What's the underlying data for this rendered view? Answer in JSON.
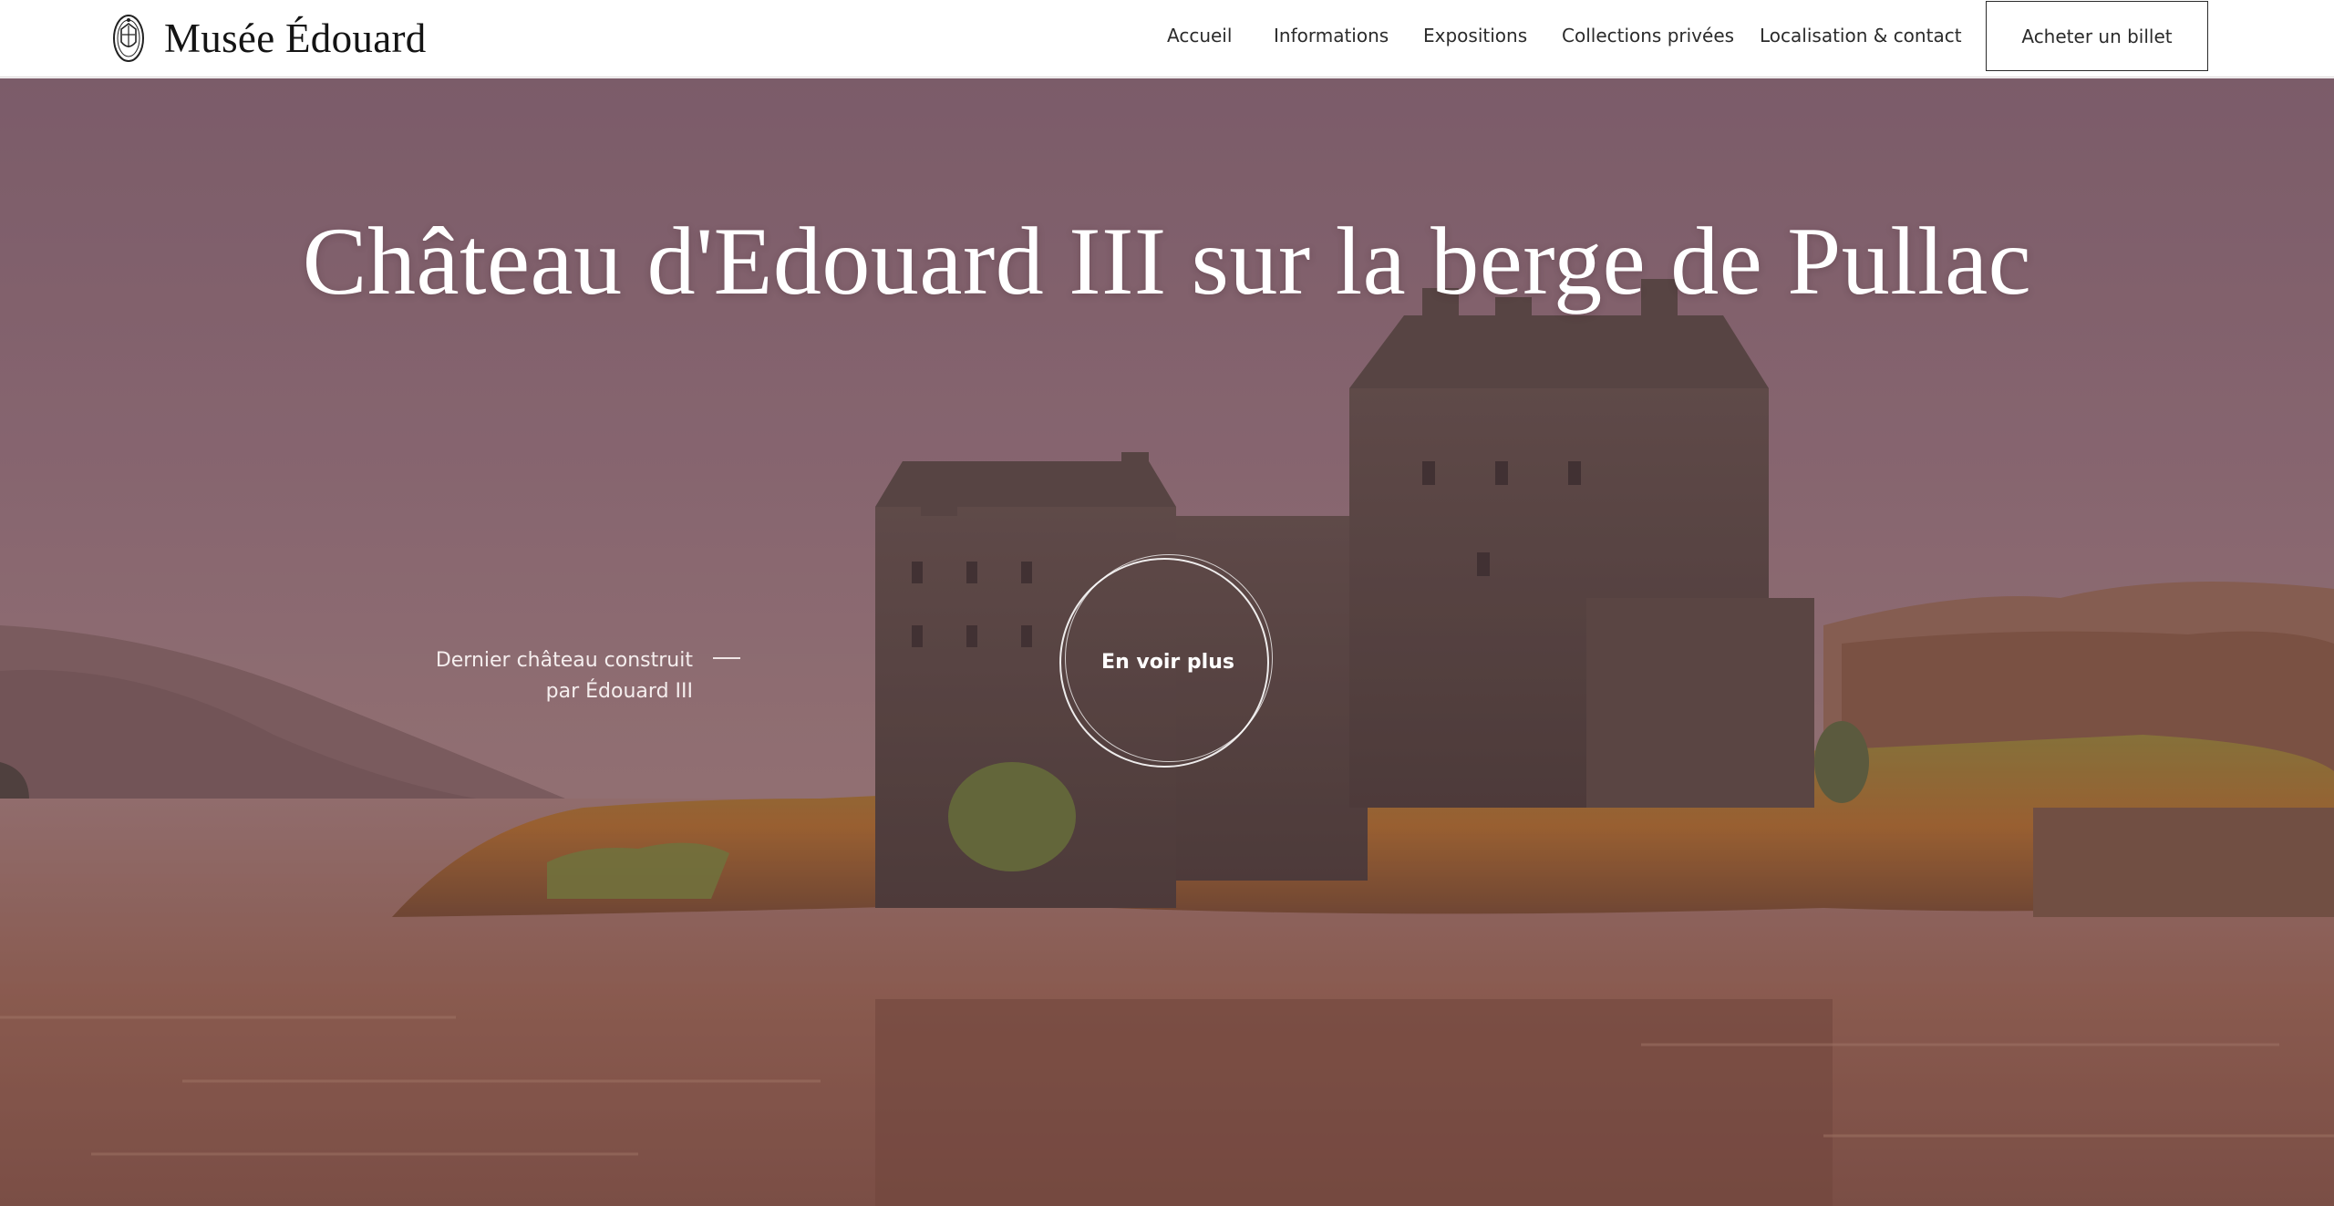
{
  "header": {
    "brand": "Musée Édouard",
    "logo_icon": "crest-icon",
    "nav": [
      {
        "label": "Accueil"
      },
      {
        "label": "Informations"
      },
      {
        "label": "Expositions"
      },
      {
        "label": "Collections privées"
      },
      {
        "label": "Localisation & contact"
      }
    ],
    "cta_label": "Acheter un billet"
  },
  "hero": {
    "title": "Château d'Edouard III sur la berge de Pullac",
    "caption_line1": "Dernier château construit",
    "caption_line2": "par Édouard III",
    "cta_label": "En voir plus",
    "overlay_color": "#7a5a66"
  }
}
